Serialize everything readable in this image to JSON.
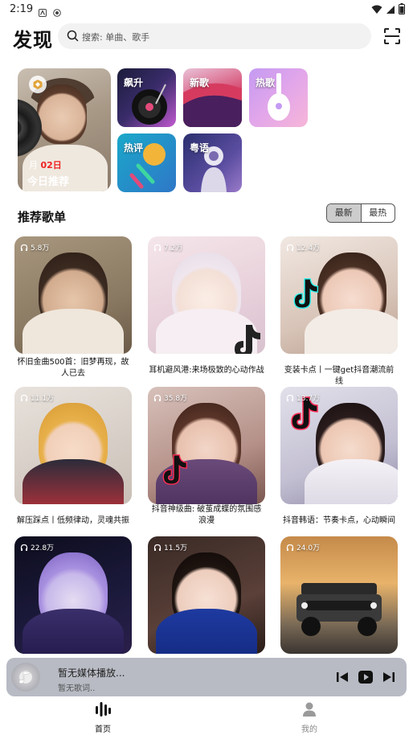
{
  "status_bar": {
    "time": "2:19"
  },
  "header": {
    "title": "发现",
    "search_placeholder": "搜索: 单曲、歌手"
  },
  "daily": {
    "month": "月",
    "day": "02日",
    "title": "今日推荐"
  },
  "tiles": [
    {
      "label": "飙升"
    },
    {
      "label": "新歌"
    },
    {
      "label": "热歌"
    },
    {
      "label": "热评"
    },
    {
      "label": "粤语"
    }
  ],
  "section": {
    "title": "推荐歌单",
    "tabs": [
      "最新",
      "最热"
    ],
    "active_tab": "最新"
  },
  "playlists": [
    {
      "plays": "5.8万",
      "name": "怀旧金曲500首：旧梦再现，故人已去"
    },
    {
      "plays": "7.2万",
      "name": "耳机避风港:来场极致的心动作战"
    },
    {
      "plays": "12.4万",
      "name": "变装卡点丨一键get抖音潮流前线"
    },
    {
      "plays": "11.1万",
      "name": "解压踩点丨低频律动，灵魂共振"
    },
    {
      "plays": "35.8万",
      "name": "抖音神级曲: 破茧成蝶的氛围感浪漫"
    },
    {
      "plays": "13.7万",
      "name": "抖音韩语：节奏卡点，心动瞬间"
    },
    {
      "plays": "22.8万",
      "name": ""
    },
    {
      "plays": "11.5万",
      "name": ""
    },
    {
      "plays": "24.0万",
      "name": ""
    }
  ],
  "player": {
    "title": "暂无媒体播放...",
    "subtitle": "暂无歌词.."
  },
  "nav": {
    "home": "首页",
    "mine": "我的"
  },
  "colors": {
    "accent": "#e22222",
    "player_bg": "#b8bbc4"
  }
}
